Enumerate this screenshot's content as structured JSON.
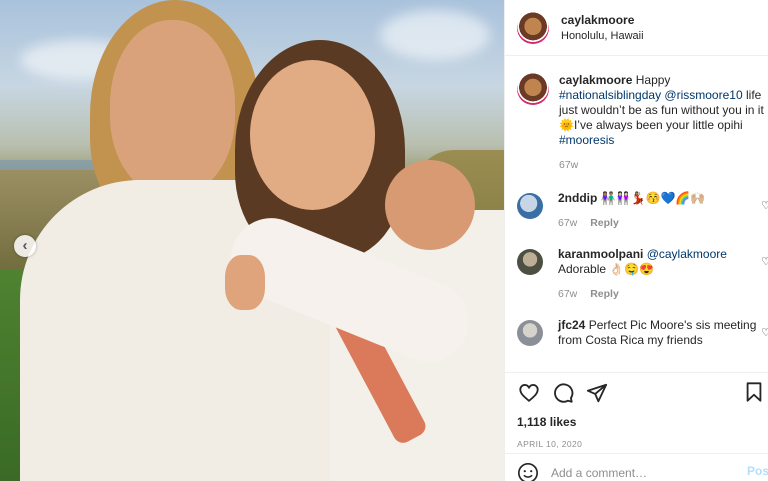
{
  "post": {
    "username": "caylakmoore",
    "location": "Honolulu, Hawaii"
  },
  "caption": {
    "username": "caylakmoore",
    "text_1": "Happy",
    "hashtag_1": "#nationalsiblingday",
    "mention": "@rissmoore10",
    "text_2": "life just wouldn’t be as fun without you in it",
    "sun_emoji": "🌞",
    "text_3": "I’ve always been your little opihi",
    "hashtag_2": "#mooresis",
    "time": "67w"
  },
  "comments": [
    {
      "username": "2nddip",
      "text": "👫🏽👭🏻💃🏽😚💙🌈🙌🏼",
      "time": "67w",
      "reply": "Reply"
    },
    {
      "username": "karanmoolpani",
      "mention": "@caylakmoore",
      "text": "Adorable 👌🏻🤤😍",
      "time": "67w",
      "reply": "Reply"
    },
    {
      "username": "jfc24",
      "text": "Perfect Pic Moore's sis meeting from Costa Rica my friends"
    }
  ],
  "icons": {
    "carousel_prev": "chevron-left-icon",
    "like": "heart-icon",
    "comment": "comment-bubble-icon",
    "share": "paper-plane-icon",
    "save": "bookmark-icon",
    "emoji": "smiley-icon"
  },
  "stats": {
    "likes": "1,118 likes",
    "date": "APRIL 10, 2020"
  },
  "add_comment": {
    "placeholder": "Add a comment…",
    "post_label": "Post"
  },
  "colors": {
    "link": "#00376b",
    "muted": "#8e8e8e",
    "post_button_disabled": "#b2dffc"
  }
}
